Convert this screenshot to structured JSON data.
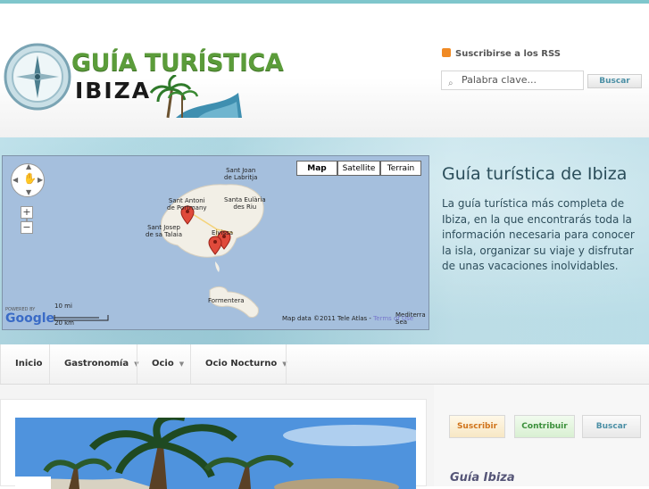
{
  "header": {
    "logo_title": "GUÍA TURÍSTICA",
    "logo_sub": "IBIZA",
    "rss_label": "Suscribirse a los RSS",
    "search_placeholder": "Palabra clave...",
    "search_button": "Buscar"
  },
  "map": {
    "type_buttons": [
      "Map",
      "Satellite",
      "Terrain"
    ],
    "selected_type": "Map",
    "places": {
      "sant_joan": "Sant Joan\nde Labritja",
      "sant_antoni": "Sant Antoni\nde Portmany",
      "santa_eularia": "Santa Eulària\ndes Riu",
      "sant_josep": "Sant Josep\nde sa Talaia",
      "eivissa": "Eivissa",
      "formentera": "Formentera",
      "sea": "Mediterra\nSea"
    },
    "scale_mi": "10 mi",
    "scale_km": "20 km",
    "powered_by": "POWERED BY",
    "google": "Google",
    "attribution": "Map data ©2011 Tele Atlas - ",
    "terms": "Terms of Use",
    "zoom_in": "+",
    "zoom_out": "−"
  },
  "banner": {
    "title": "Guía turística de Ibiza",
    "text": "La guía turística más completa de Ibiza, en la que encontrarás toda la información necesaria para conocer la isla, organizar su viaje y disfrutar de unas vacaciones inolvidables."
  },
  "nav": {
    "items": [
      "Inicio",
      "Gastronomía",
      "Ocio",
      "Ocio Nocturno"
    ],
    "caret": "▼"
  },
  "sidebar": {
    "subscribe": "Suscribir",
    "contribute": "Contribuir",
    "search": "Buscar",
    "heading": "Guía Ibiza"
  },
  "colors": {
    "accent": "#7fc6cc",
    "logo_green": "#5b9c3a",
    "link_blue": "#4b8fa5",
    "rss_orange": "#f08a24"
  }
}
